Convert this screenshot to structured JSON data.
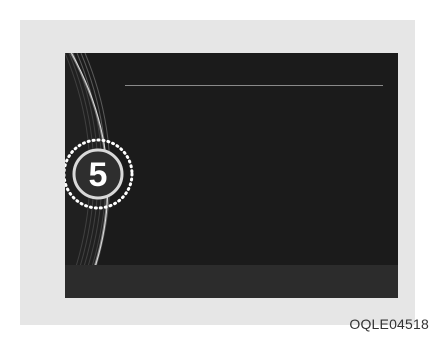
{
  "display": {
    "gear_indicator": "5"
  },
  "caption": {
    "code": "OQLE04518"
  },
  "colors": {
    "panel_bg": "#e6e6e6",
    "screen_bg": "#1b1b1b",
    "bottom_bar": "#2c2c2c",
    "indicator_ring": "#ffffff"
  }
}
